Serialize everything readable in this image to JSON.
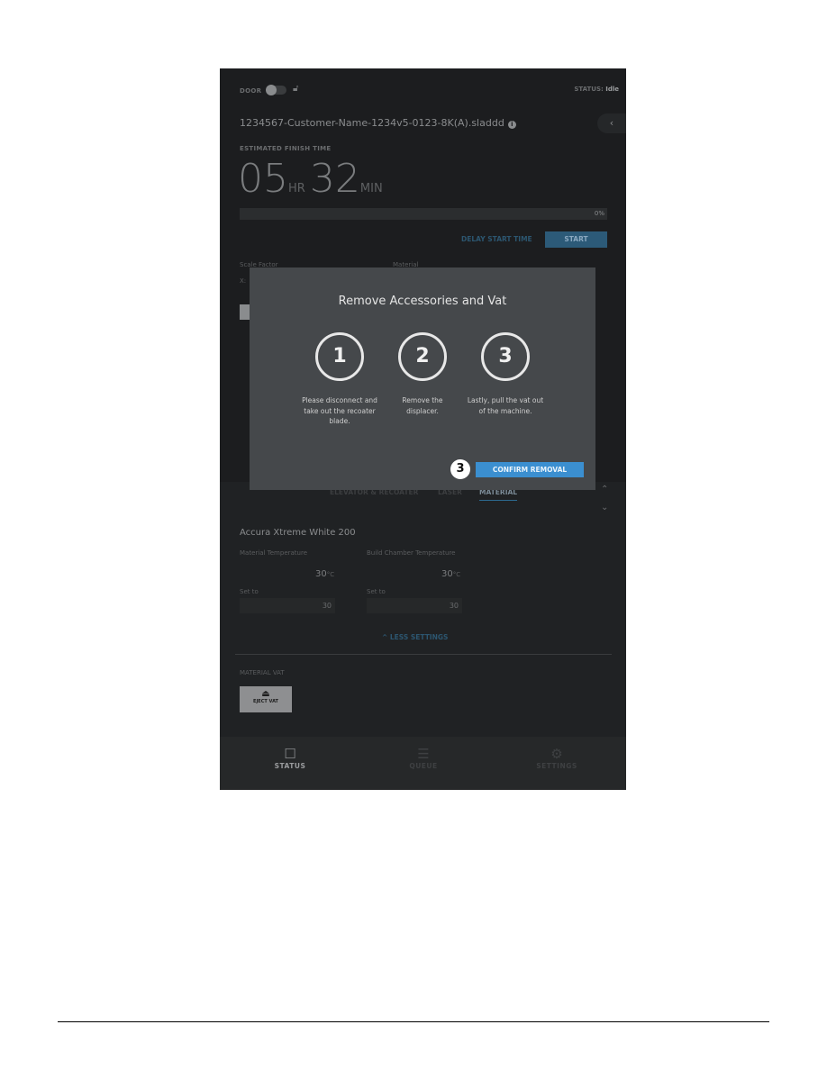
{
  "header": {
    "door_label": "DOOR",
    "door_locked": false,
    "status_label": "STATUS:",
    "status_value": "Idle"
  },
  "job": {
    "filename": "1234567-Customer-Name-1234v5-0123-8K(A).sladdd",
    "back_icon": "chevron-left-icon"
  },
  "finish": {
    "label": "ESTIMATED FINISH TIME",
    "hours": "05",
    "hr_unit": "HR",
    "minutes": "32",
    "min_unit": "MIN",
    "progress_text": "0%",
    "progress": 0
  },
  "actions": {
    "delay": "DELAY START TIME",
    "start": "START"
  },
  "behind": {
    "scale_factor": "Scale Factor",
    "material": "Material",
    "x": "X:"
  },
  "dialog": {
    "title": "Remove Accessories and Vat",
    "steps": [
      {
        "num": "1",
        "text": "Please disconnect and take out the recoater blade."
      },
      {
        "num": "2",
        "text": "Remove the displacer."
      },
      {
        "num": "3",
        "text": "Lastly, pull the vat out of the machine."
      }
    ],
    "confirm": "CONFIRM REMOVAL",
    "callout": "3"
  },
  "tabs": [
    "ELEVATOR & RECOATER",
    "LASER",
    "MATERIAL"
  ],
  "material": {
    "name": "Accura Xtreme White 200",
    "mat_temp_label": "Material Temperature",
    "mat_temp": "30",
    "chamber_label": "Build Chamber Temperature",
    "chamber_temp": "30",
    "unit": "°C",
    "set_to": "Set to",
    "set_mat": "30",
    "set_chamber": "30",
    "less": "^ LESS SETTINGS",
    "vat_label": "MATERIAL VAT",
    "eject": "EJECT VAT"
  },
  "nav": [
    {
      "label": "STATUS",
      "icon": "status-icon"
    },
    {
      "label": "QUEUE",
      "icon": "queue-icon"
    },
    {
      "label": "SETTINGS",
      "icon": "gear-icon"
    }
  ]
}
